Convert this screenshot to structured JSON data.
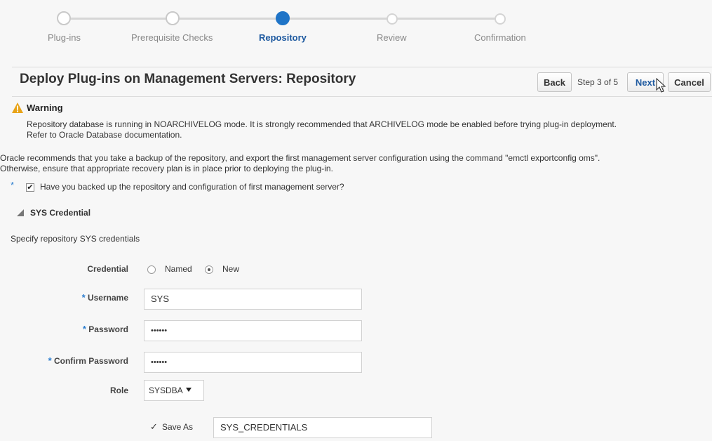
{
  "train": {
    "steps": [
      {
        "label": "Plug-ins",
        "state": "visited"
      },
      {
        "label": "Prerequisite Checks",
        "state": "visited"
      },
      {
        "label": "Repository",
        "state": "current"
      },
      {
        "label": "Review",
        "state": "unvisited"
      },
      {
        "label": "Confirmation",
        "state": "unvisited"
      }
    ]
  },
  "header": {
    "title": "Deploy Plug-ins on Management Servers: Repository",
    "back_label": "Back",
    "step_text": "Step 3 of 5",
    "next_label": "Next",
    "cancel_label": "Cancel"
  },
  "warning": {
    "title": "Warning",
    "line1": "Repository database is running in NOARCHIVELOG mode. It is strongly recommended that ARCHIVELOG mode be enabled before trying plug-in deployment.",
    "line2": "Refer to Oracle Database documentation."
  },
  "recommendation": {
    "line1": "Oracle recommends that you take a backup of the repository, and export the first management server configuration using the command \"emctl exportconfig oms\".",
    "line2": "Otherwise, ensure that appropriate recovery plan is in place prior to deploying the plug-in."
  },
  "backup_check": {
    "required_marker": "*",
    "checked": true,
    "label": "Have you backed up the repository and configuration of first management server?"
  },
  "sys_credential": {
    "section_title": "SYS Credential",
    "description": "Specify repository SYS credentials",
    "credential_label": "Credential",
    "option_named": "Named",
    "option_new": "New",
    "selected_option": "New",
    "username_label": "Username",
    "username_value": "SYS",
    "password_label": "Password",
    "password_value": "••••••",
    "confirm_label": "Confirm Password",
    "confirm_value": "••••••",
    "role_label": "Role",
    "role_value": "SYSDBA",
    "save_as_check": "✓",
    "save_as_label": "Save As",
    "save_as_value": "SYS_CREDENTIALS",
    "required_marker": "*"
  },
  "colors": {
    "accent": "#1f74c7",
    "warning": "#e8a317",
    "required": "#2f7fcf"
  }
}
